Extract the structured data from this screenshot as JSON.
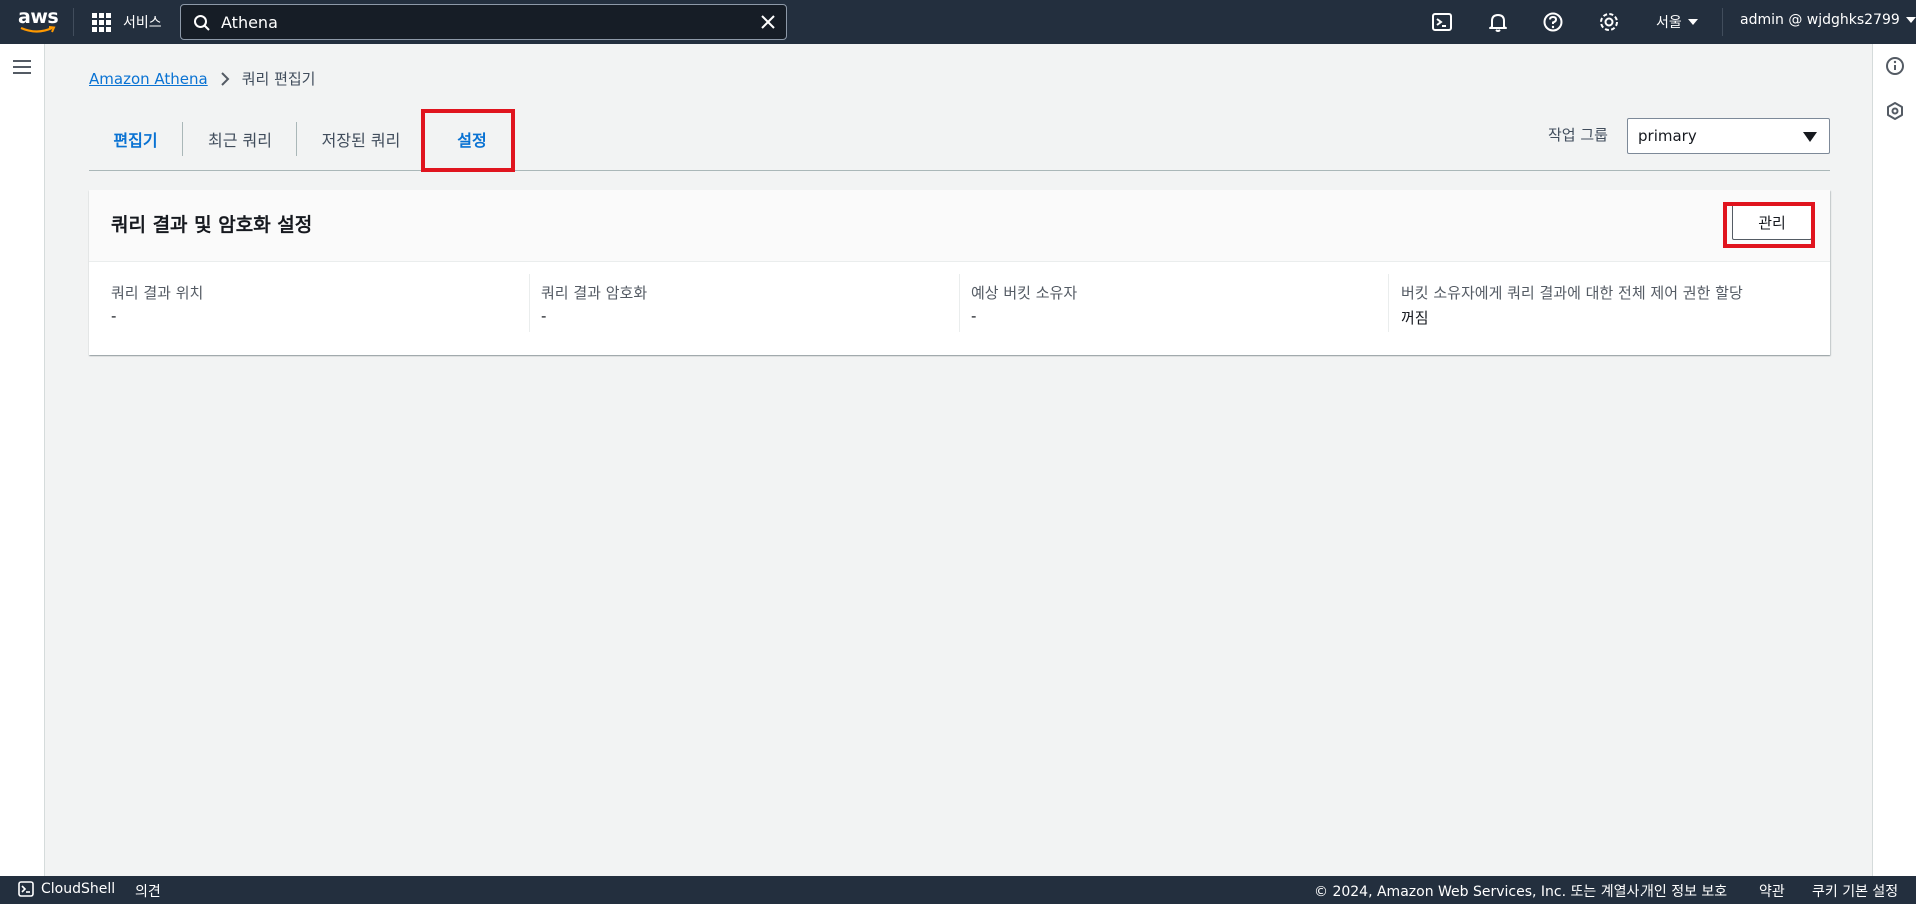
{
  "topnav": {
    "logo_text": "aws",
    "services_label": "서비스",
    "search_value": "Athena",
    "region_label": "서울",
    "account_label": "admin @ wjdghks2799",
    "icons": [
      "cloudshell-icon",
      "bell-icon",
      "help-icon",
      "gear-icon"
    ]
  },
  "breadcrumb": {
    "root": "Amazon Athena",
    "current": "쿼리 편집기"
  },
  "tabs": [
    {
      "label": "편집기",
      "active": true
    },
    {
      "label": "최근 쿼리",
      "active": false
    },
    {
      "label": "저장된 쿼리",
      "active": false
    },
    {
      "label": "설정",
      "active": true
    }
  ],
  "workgroup": {
    "label": "작업 그룹",
    "value": "primary"
  },
  "panel": {
    "title": "쿼리 결과 및 암호화 설정",
    "manage_label": "관리",
    "columns": [
      {
        "label": "쿼리 결과 위치",
        "value": "-"
      },
      {
        "label": "쿼리 결과 암호화",
        "value": "-"
      },
      {
        "label": "예상 버킷 소유자",
        "value": "-"
      },
      {
        "label": "버킷 소유자에게 쿼리 결과에 대한 전체 제어 권한 할당",
        "value": "꺼짐"
      }
    ]
  },
  "footer": {
    "cloudshell": "CloudShell",
    "feedback": "의견",
    "copyright": "© 2024, Amazon Web Services, Inc. 또는 계열사.",
    "privacy": "개인 정보 보호",
    "terms": "약관",
    "cookies": "쿠키 기본 설정"
  },
  "colors": {
    "nav_bg": "#232f3e",
    "link": "#0972d3",
    "highlight": "#e0141e"
  }
}
